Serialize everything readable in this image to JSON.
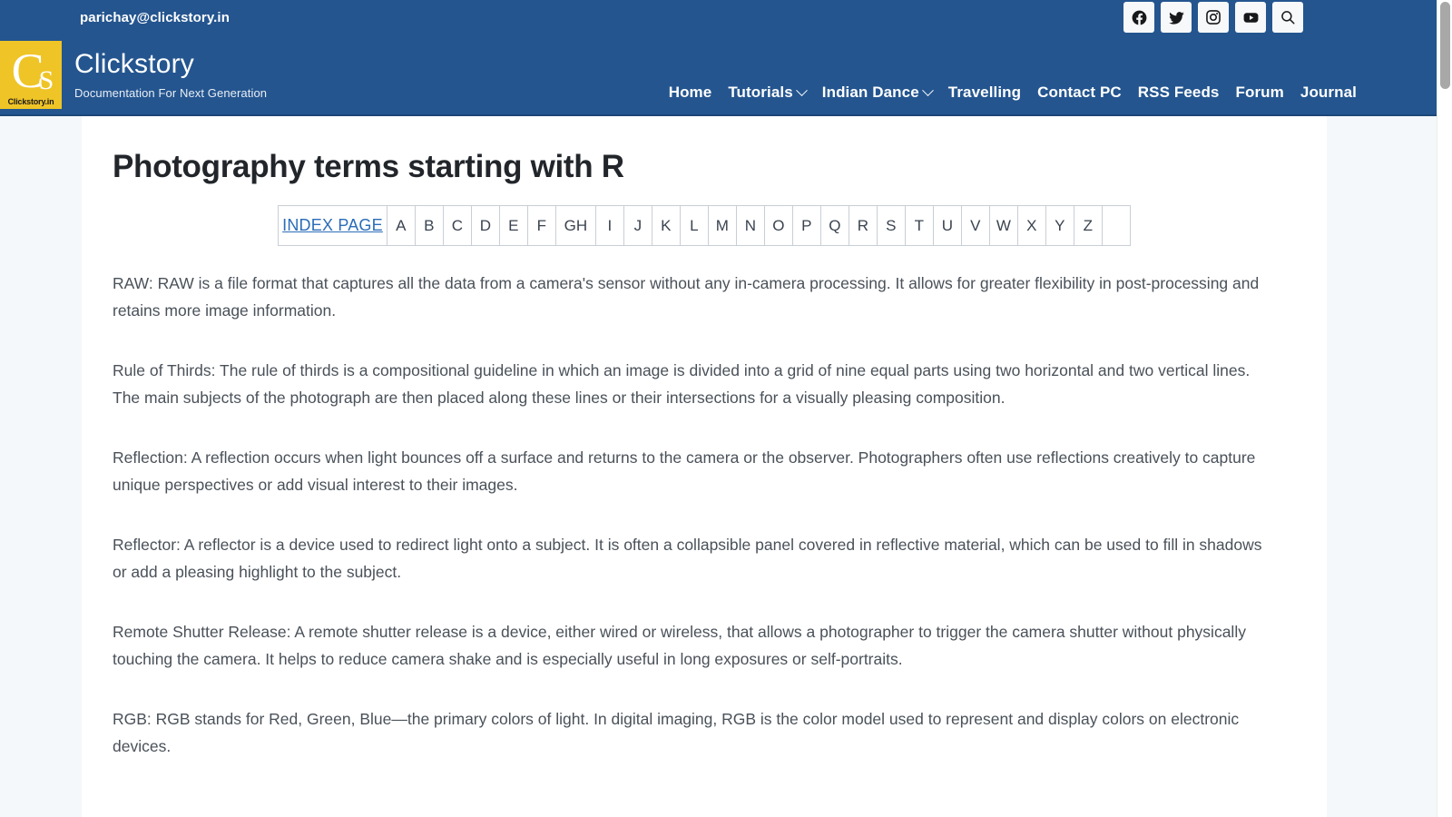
{
  "topbar": {
    "email": "parichay@clickstory.in",
    "social": [
      {
        "name": "facebook-icon",
        "label": "Facebook"
      },
      {
        "name": "twitter-icon",
        "label": "Twitter"
      },
      {
        "name": "instagram-icon",
        "label": "Instagram"
      },
      {
        "name": "youtube-icon",
        "label": "YouTube"
      }
    ],
    "search_label": "Search"
  },
  "header": {
    "logo_mark": "CS",
    "logo_caption": "Clickstory.in",
    "site_title": "Clickstory",
    "tagline": "Documentation For Next Generation",
    "nav": [
      {
        "label": "Home",
        "dropdown": false
      },
      {
        "label": "Tutorials",
        "dropdown": true
      },
      {
        "label": "Indian Dance",
        "dropdown": true
      },
      {
        "label": "Travelling",
        "dropdown": false
      },
      {
        "label": "Contact PC",
        "dropdown": false
      },
      {
        "label": "RSS Feeds",
        "dropdown": false
      },
      {
        "label": "Forum",
        "dropdown": false
      },
      {
        "label": "Journal",
        "dropdown": false
      }
    ]
  },
  "main": {
    "page_title": "Photography terms starting with R",
    "index_link": "INDEX PAGE",
    "letters": [
      "A",
      "B",
      "C",
      "D",
      "E",
      "F",
      "GH",
      "I",
      "J",
      "K",
      "L",
      "M",
      "N",
      "O",
      "P",
      "Q",
      "R",
      "S",
      "T",
      "U",
      "V",
      "W",
      "X",
      "Y",
      "Z",
      ""
    ],
    "paragraphs": [
      "RAW: RAW is a file format that captures all the data from a camera's sensor without any in-camera processing. It allows for greater flexibility in post-processing and retains more image information.",
      "Rule of Thirds: The rule of thirds is a compositional guideline in which an image is divided into a grid of nine equal parts using two horizontal and two vertical lines. The main subjects of the photograph are then placed along these lines or their intersections for a visually pleasing composition.",
      "Reflection: A reflection occurs when light bounces off a surface and returns to the camera or the observer. Photographers often use reflections creatively to capture unique perspectives or add visual interest to their images.",
      "Reflector: A reflector is a device used to redirect light onto a subject. It is often a collapsible panel covered in reflective material, which can be used to fill in shadows or add a pleasing highlight to the subject.",
      "Remote Shutter Release: A remote shutter release is a device, either wired or wireless, that allows a photographer to trigger the camera shutter without physically touching the camera. It helps to reduce camera shake and is especially useful in long exposures or self-portraits.",
      "RGB: RGB stands for Red, Green, Blue—the primary colors of light. In digital imaging, RGB is the color model used to represent and display colors on electronic devices."
    ]
  },
  "colors": {
    "brand_blue": "#24558f",
    "logo_yellow": "#efc427",
    "link_blue": "#2b6cb8",
    "page_bg": "#f4f8fb"
  }
}
